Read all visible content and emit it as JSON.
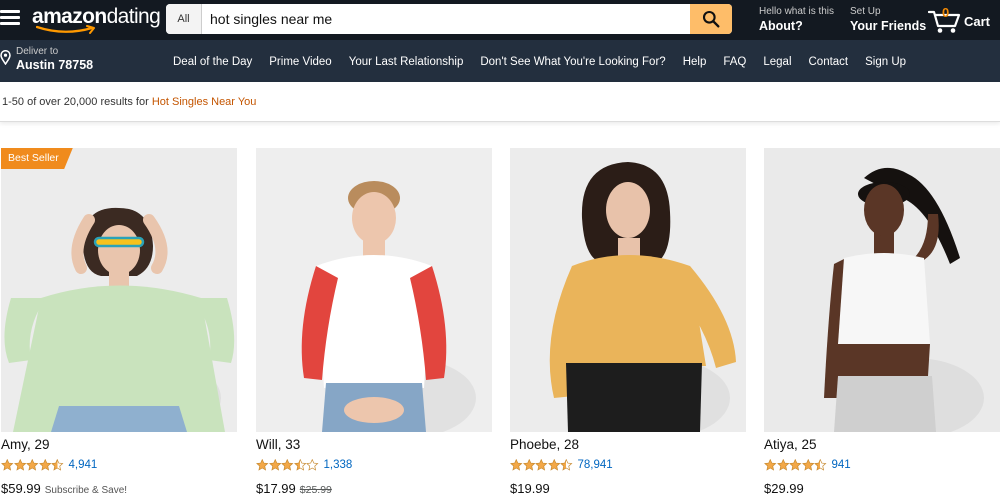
{
  "header": {
    "logo_bold": "amazon",
    "logo_light": "dating",
    "search": {
      "category": "All",
      "query": "hot singles near me"
    },
    "account": {
      "line1": "Hello what is this",
      "line2": "About?"
    },
    "friends": {
      "line1": "Set Up",
      "line2": "Your Friends"
    },
    "cart": {
      "count": "0",
      "label": "Cart"
    },
    "deliver": {
      "line1": "Deliver to",
      "line2": "Austin 78758"
    },
    "nav": [
      "Deal of the Day",
      "Prime Video",
      "Your Last Relationship",
      "Don't See What You're Looking For?",
      "Help",
      "FAQ",
      "Legal",
      "Contact",
      "Sign Up"
    ]
  },
  "results": {
    "summary": "1-50 of over 20,000 results for",
    "query": "Hot Singles Near You"
  },
  "products": [
    {
      "name": "Amy, 29",
      "rating": 4.5,
      "review_count": "4,941",
      "price": "$59.99",
      "note": "Subscribe & Save!",
      "badge": "Best Seller",
      "palette": {
        "bg": "#ececec",
        "hair": "#3b2a22",
        "skin": "#e9c5ad",
        "top": "#c9e3bd",
        "bottom": "#8fb0cf"
      }
    },
    {
      "name": "Will, 33",
      "rating": 3.5,
      "review_count": "1,338",
      "price": "$17.99",
      "was_price": "$25.99",
      "palette": {
        "bg": "#eeeeee",
        "hair": "#b98c5d",
        "skin": "#edc6ad",
        "top": "#ffffff",
        "sleeve": "#e2453e",
        "bottom": "#86a6c6"
      }
    },
    {
      "name": "Phoebe, 28",
      "rating": 4.5,
      "review_count": "78,941",
      "price": "$19.99",
      "palette": {
        "bg": "#ececec",
        "hair": "#2b1d17",
        "skin": "#e8c2aa",
        "top": "#eab45a",
        "bottom": "#1d1d1d"
      }
    },
    {
      "name": "Atiya, 25",
      "rating": 4.5,
      "review_count": "941",
      "price": "$29.99",
      "palette": {
        "bg": "#eaeaea",
        "hair": "#15110f",
        "skin": "#5a3626",
        "top": "#f7f7f7",
        "bottom": "#cfcfcf"
      }
    }
  ],
  "colors": {
    "topbar": "#131921",
    "subbar": "#232f3e",
    "search_button": "#febd69",
    "badge": "#f08b1d",
    "star": "#f3a847",
    "link": "#0066c0",
    "query_highlight": "#c45500"
  },
  "icons": [
    "hamburger-menu-icon",
    "search-icon",
    "location-pin-icon",
    "cart-icon",
    "star-icon",
    "amazon-smile-logo"
  ]
}
